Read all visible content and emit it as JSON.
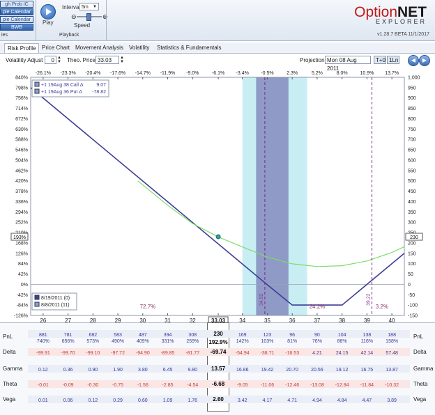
{
  "ribbon": {
    "strategies": [
      "gh Prob IC",
      "ple Calendar",
      "ple Calendar",
      "BWB"
    ],
    "strategies_group_label": "ies",
    "play_label": "Play",
    "interval_label": "Interval",
    "interval_value": "5m",
    "speed_label": "Speed",
    "playback_label": "Playback"
  },
  "app": {
    "logo_primary": "Option",
    "logo_secondary": "NET",
    "logo_sub": "EXPLORER",
    "version": "v1.28.7 BETA 11/1/2017"
  },
  "tabs": [
    "Risk Profile",
    "Price Chart",
    "Movement Analysis",
    "Volatility",
    "Statistics & Fundamentals"
  ],
  "controls": {
    "volatility_adjust_label": "Volatility Adjust",
    "volatility_adjust_value": "0",
    "theo_price_label": "Theo. Price",
    "theo_price_value": "33.03",
    "projection_label": "Projection",
    "projection_date": "Mon 08 Aug  2011",
    "t0_label": "T+0",
    "one_ln_label": "1Ln"
  },
  "chart_data": {
    "type": "line",
    "x_range": [
      25.5,
      40.5
    ],
    "x_ticks": [
      26,
      27,
      28,
      29,
      30,
      31,
      32,
      33.03,
      34,
      35,
      36,
      37,
      38,
      39,
      40
    ],
    "pct_ticks": [
      {
        "x": 26,
        "label": "-26.1%"
      },
      {
        "x": 27,
        "label": "-23.3%"
      },
      {
        "x": 28,
        "label": "-20.4%"
      },
      {
        "x": 29,
        "label": "-17.6%"
      },
      {
        "x": 30,
        "label": "-14.7%"
      },
      {
        "x": 31,
        "label": "-11.9%"
      },
      {
        "x": 32,
        "label": "-9.0%"
      },
      {
        "x": 33.03,
        "label": "-6.1%"
      },
      {
        "x": 34,
        "label": "-3.4%"
      },
      {
        "x": 35,
        "label": "-0.5%"
      },
      {
        "x": 36,
        "label": "2.3%"
      },
      {
        "x": 37,
        "label": "5.2%"
      },
      {
        "x": 38,
        "label": "8.0%"
      },
      {
        "x": 39,
        "label": "10.9%"
      },
      {
        "x": 40,
        "label": "13.7%"
      }
    ],
    "left_axis": {
      "min": -126,
      "max": 840,
      "ticks": [
        "840%",
        "798%",
        "756%",
        "714%",
        "672%",
        "630%",
        "588%",
        "546%",
        "504%",
        "462%",
        "420%",
        "378%",
        "336%",
        "294%",
        "252%",
        "210%",
        "168%",
        "126%",
        "84%",
        "42%",
        "0%",
        "-42%",
        "-84%",
        "-126%"
      ],
      "current": "193%"
    },
    "right_axis": {
      "min": -150,
      "max": 1000,
      "ticks": [
        "1,000",
        "950",
        "900",
        "850",
        "800",
        "750",
        "700",
        "650",
        "600",
        "550",
        "500",
        "450",
        "400",
        "350",
        "300",
        "250",
        "200",
        "150",
        "100",
        "50",
        "0",
        "-50",
        "-100",
        "-150"
      ],
      "current": "230"
    },
    "legend_top": [
      {
        "label": "+1 19Aug 38 Call Δ",
        "value": "9.07"
      },
      {
        "label": "+1 19Aug 36 Put Δ",
        "value": "-78.82"
      }
    ],
    "legend_bottom": [
      {
        "label": "8/19/2011 (0)",
        "color": "#4040a0"
      },
      {
        "label": "8/8/2011 (11)",
        "color": "#8aa0d8"
      }
    ],
    "series": [
      {
        "name": "8/19/2011 (0)",
        "color": "#3c3c96",
        "points": [
          [
            25.5,
            950
          ],
          [
            35.0,
            -2
          ],
          [
            36.0,
            -100
          ],
          [
            38.0,
            -100
          ],
          [
            40.5,
            150
          ]
        ]
      },
      {
        "name": "8/8/2011 (11)",
        "color": "#7ddc6a",
        "points": [
          [
            29.8,
            500
          ],
          [
            31,
            382
          ],
          [
            32,
            294
          ],
          [
            33.03,
            229
          ],
          [
            34,
            181
          ],
          [
            35,
            132
          ],
          [
            36,
            99
          ],
          [
            37,
            86
          ],
          [
            38,
            90
          ],
          [
            39,
            113
          ],
          [
            40,
            154
          ],
          [
            40.5,
            182
          ]
        ]
      }
    ],
    "bands": {
      "outer": [
        34.0,
        36.6
      ],
      "inner": [
        34.55,
        35.85
      ]
    },
    "vertical_markers": [
      {
        "x": 34.9,
        "label": "34.92"
      },
      {
        "x": 39.2,
        "label": "39.22"
      }
    ],
    "zone_labels": [
      {
        "x": 30.2,
        "label": "72.7%"
      },
      {
        "x": 37.0,
        "label": "24.2%"
      },
      {
        "x": 39.6,
        "label": "3.2%"
      }
    ]
  },
  "table": {
    "columns": [
      "26",
      "27",
      "28",
      "29",
      "30",
      "31",
      "32",
      "33.03",
      "34",
      "35",
      "36",
      "37",
      "38",
      "39",
      "40"
    ],
    "current_index": 7,
    "rows": [
      {
        "label": "PnL",
        "top": [
          "881",
          "781",
          "682",
          "583",
          "487",
          "394",
          "308",
          "230",
          "169",
          "123",
          "96",
          "90",
          "104",
          "138",
          "188"
        ],
        "bottom": [
          "740%",
          "656%",
          "573%",
          "490%",
          "409%",
          "331%",
          "259%",
          "192.9%",
          "142%",
          "103%",
          "81%",
          "76%",
          "88%",
          "116%",
          "158%"
        ]
      },
      {
        "label": "Delta",
        "top": [
          "-99.91",
          "-99.70",
          "-99.10",
          "-97.72",
          "-94.90",
          "-89.85",
          "-81.77",
          "-69.74",
          "-54.94",
          "-38.71",
          "-16.53",
          "4.21",
          "24.15",
          "42.14",
          "57.48"
        ]
      },
      {
        "label": "Gamma",
        "top": [
          "0.12",
          "0.36",
          "0.90",
          "1.90",
          "3.80",
          "6.45",
          "9.80",
          "13.57",
          "16.86",
          "19.42",
          "20.70",
          "20.56",
          "19.12",
          "16.75",
          "13.87"
        ]
      },
      {
        "label": "Theta",
        "top": [
          "-0.01",
          "-0.09",
          "-0.30",
          "-0.75",
          "-1.56",
          "-2.85",
          "-4.54",
          "-6.68",
          "-9.05",
          "-11.06",
          "-12.46",
          "-13.08",
          "-12.84",
          "-11.84",
          "-10.32"
        ]
      },
      {
        "label": "Vega",
        "top": [
          "0.01",
          "0.06",
          "0.12",
          "0.29",
          "0.60",
          "1.09",
          "1.76",
          "2.60",
          "3.42",
          "4.17",
          "4.71",
          "4.94",
          "4.84",
          "4.47",
          "3.89"
        ]
      }
    ]
  },
  "colors": {
    "accent": "#2f62ad",
    "brand": "#c01818",
    "expiry_line": "#3c3c96",
    "t0_line": "#7ddc6a",
    "band_outer": "#c8eef4",
    "band_inner": "#8f9ac6"
  }
}
